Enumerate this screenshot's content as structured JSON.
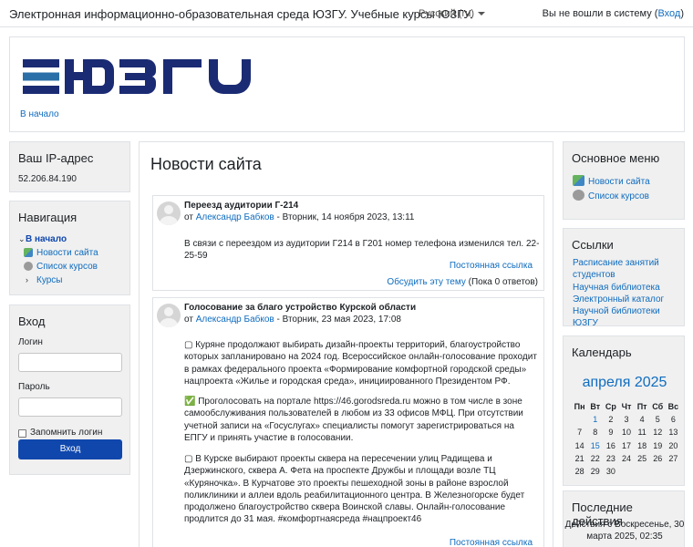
{
  "topbar": {
    "site_name": "Электронная информационно-образовательная среда ЮЗГУ. Учебные курсы ЮЗГУ.",
    "language": "Русский (ru)",
    "not_logged_in": "Вы не вошли в систему (",
    "login_link": "Вход",
    "login_close": ")"
  },
  "header": {
    "logo_text": "ЮЗГУ",
    "breadcrumb_home": "В начало"
  },
  "ip_block": {
    "title": "Ваш IP-адрес",
    "ip": "52.206.84.190"
  },
  "navigation": {
    "title": "Навигация",
    "home": "В начало",
    "news": "Новости сайта",
    "courses_list": "Список курсов",
    "courses": "Курсы"
  },
  "login_block": {
    "title": "Вход",
    "username_label": "Логин",
    "password_label": "Пароль",
    "remember": "Запомнить логин",
    "submit": "Вход"
  },
  "main": {
    "title": "Новости сайта",
    "posts": [
      {
        "subject": "Переезд аудитории Г-214",
        "by": "от ",
        "author": "Александр Бабков",
        "date": " - Вторник, 14 ноября 2023, 13:11",
        "paragraphs": [
          "В связи с переездом из аудитории Г214 в Г201 номер телефона изменился тел. 22-25-59"
        ],
        "permalink": "Постоянная ссылка",
        "discuss": "Обсудить эту тему",
        "replies": " (Пока 0 ответов)"
      },
      {
        "subject": "Голосование за благо устройство Курской области",
        "by": "от ",
        "author": "Александр Бабков",
        "date": " - Вторник, 23 мая 2023, 17:08",
        "paragraphs": [
          "▢ Куряне продолжают выбирать дизайн-проекты территорий, благоустройство которых запланировано на 2024 год. Всероссийское онлайн-голосование проходит в рамках федерального проекта «Формирование комфортной городской среды» нацпроекта «Жилье и городская среда», инициированного Президентом РФ.",
          "✅ Проголосовать на портале https://46.gorodsreda.ru можно в том числе в зоне самообслуживания пользователей в любом из 33 офисов МФЦ. При отсутствии учетной записи на «Госуслугах» специалисты помогут зарегистрироваться на ЕПГУ и принять участие в голосовании.",
          "▢ В Курске выбирают проекты сквера на пересечении улиц Радищева и Дзержинского, сквера А. Фета на проспекте Дружбы и площади возле ТЦ «Куряночка». В Курчатове это проекты пешеходной зоны в районе взрослой поликлиники и аллеи вдоль реабилитационного центра. В Железногорске будет продолжено благоустройство сквера Воинской славы. Онлайн-голосование продлится до 31 мая. #комфортнаясреда #нацпроект46"
        ],
        "permalink": "Постоянная ссылка"
      }
    ]
  },
  "main_menu": {
    "title": "Основное меню",
    "items": [
      "Новости сайта",
      "Список курсов"
    ]
  },
  "links_block": {
    "title": "Ссылки",
    "items": [
      "Расписание занятий студентов",
      "Научная библиотека",
      "Электронный каталог Научной библиотеки ЮЗГУ"
    ]
  },
  "calendar": {
    "title": "Календарь",
    "month": "апреля 2025",
    "weekdays": [
      "Пн",
      "Вт",
      "Ср",
      "Чт",
      "Пт",
      "Сб",
      "Вс"
    ],
    "days": [
      "",
      "1",
      "2",
      "3",
      "4",
      "5",
      "6",
      "7",
      "8",
      "9",
      "10",
      "11",
      "12",
      "13",
      "14",
      "15",
      "16",
      "17",
      "18",
      "19",
      "20",
      "21",
      "22",
      "23",
      "24",
      "25",
      "26",
      "27",
      "28",
      "29",
      "30",
      "",
      "",
      "",
      ""
    ],
    "linked_days": [
      "1",
      "15"
    ]
  },
  "recent": {
    "title": "Последние действия",
    "text": "Действия с Воскресенье, 30 марта 2025, 02:35"
  },
  "colors": {
    "link": "#0f6cbf",
    "button": "#0f47ad",
    "logo": "#1b2b73"
  }
}
